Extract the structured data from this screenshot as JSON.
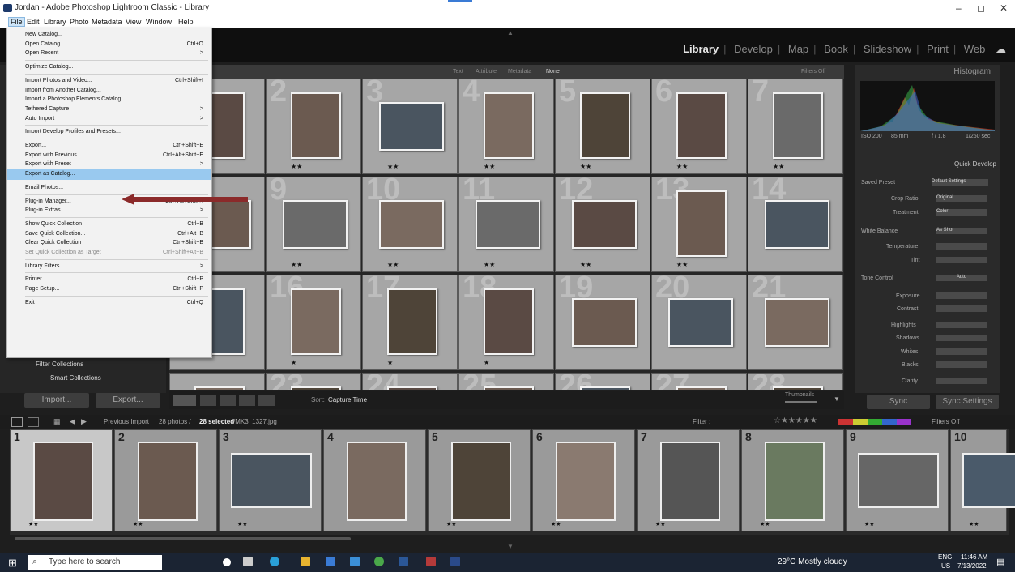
{
  "window": {
    "title": "Jordan - Adobe Photoshop Lightroom Classic - Library",
    "min": "–",
    "max": "◻",
    "close": "✕"
  },
  "menubar": [
    "File",
    "Edit",
    "Library",
    "Photo",
    "Metadata",
    "View",
    "Window",
    "Help"
  ],
  "modules": [
    "Library",
    "Develop",
    "Map",
    "Book",
    "Slideshow",
    "Print",
    "Web"
  ],
  "filter_bar": {
    "items": [
      "Text",
      "Attribute",
      "Metadata",
      "None"
    ],
    "right": "Filters Off"
  },
  "file_menu": [
    {
      "label": "New Catalog...",
      "shortcut": ""
    },
    {
      "label": "Open Catalog...",
      "shortcut": "Ctrl+O"
    },
    {
      "label": "Open Recent",
      "shortcut": ">"
    },
    {
      "sep": true
    },
    {
      "label": "Optimize Catalog...",
      "shortcut": ""
    },
    {
      "sep": true
    },
    {
      "label": "Import Photos and Video...",
      "shortcut": "Ctrl+Shift+I"
    },
    {
      "label": "Import from Another Catalog...",
      "shortcut": ""
    },
    {
      "label": "Import a Photoshop Elements Catalog...",
      "shortcut": ""
    },
    {
      "label": "Tethered Capture",
      "shortcut": ">"
    },
    {
      "label": "Auto Import",
      "shortcut": ">"
    },
    {
      "sep": true
    },
    {
      "label": "Import Develop Profiles and Presets...",
      "shortcut": ""
    },
    {
      "sep": true
    },
    {
      "label": "Export...",
      "shortcut": "Ctrl+Shift+E"
    },
    {
      "label": "Export with Previous",
      "shortcut": "Ctrl+Alt+Shift+E"
    },
    {
      "label": "Export with Preset",
      "shortcut": ">"
    },
    {
      "label": "Export as Catalog...",
      "shortcut": "",
      "highlight": true
    },
    {
      "sep": true
    },
    {
      "label": "Email Photos...",
      "shortcut": ""
    },
    {
      "sep": true
    },
    {
      "label": "Plug-in Manager...",
      "shortcut": "Ctrl+Alt+Shift+,"
    },
    {
      "label": "Plug-in Extras",
      "shortcut": ">"
    },
    {
      "sep": true
    },
    {
      "label": "Show Quick Collection",
      "shortcut": "Ctrl+B"
    },
    {
      "label": "Save Quick Collection...",
      "shortcut": "Ctrl+Alt+B"
    },
    {
      "label": "Clear Quick Collection",
      "shortcut": "Ctrl+Shift+B"
    },
    {
      "label": "Set Quick Collection as Target",
      "shortcut": "Ctrl+Shift+Alt+B",
      "dim": true
    },
    {
      "sep": true
    },
    {
      "label": "Library Filters",
      "shortcut": ">"
    },
    {
      "sep": true
    },
    {
      "label": "Printer...",
      "shortcut": "Ctrl+P"
    },
    {
      "label": "Page Setup...",
      "shortcut": "Ctrl+Shift+P"
    },
    {
      "sep": true
    },
    {
      "label": "Exit",
      "shortcut": "Ctrl+Q"
    }
  ],
  "left_panel": {
    "filter_collections": "Filter Collections",
    "smart_collections": "Smart Collections",
    "import": "Import...",
    "export": "Export..."
  },
  "grid": {
    "rows": [
      [
        {
          "n": "",
          "stars": ""
        },
        {
          "n": "2",
          "stars": "★★"
        },
        {
          "n": "3",
          "stars": "★★"
        },
        {
          "n": "4",
          "stars": "★★"
        },
        {
          "n": "5",
          "stars": "★★"
        },
        {
          "n": "6",
          "stars": "★★"
        },
        {
          "n": "7",
          "stars": "★★"
        }
      ],
      [
        {
          "n": "",
          "stars": ""
        },
        {
          "n": "9",
          "stars": "★★"
        },
        {
          "n": "10",
          "stars": "★★"
        },
        {
          "n": "11",
          "stars": "★★"
        },
        {
          "n": "12",
          "stars": "★★"
        },
        {
          "n": "13",
          "stars": "★★"
        },
        {
          "n": "14",
          "stars": ""
        }
      ],
      [
        {
          "n": "",
          "stars": ""
        },
        {
          "n": "16",
          "stars": "★"
        },
        {
          "n": "17",
          "stars": "★"
        },
        {
          "n": "18",
          "stars": "★"
        },
        {
          "n": "19",
          "stars": ""
        },
        {
          "n": "20",
          "stars": ""
        },
        {
          "n": "21",
          "stars": ""
        }
      ],
      [
        {
          "n": "",
          "stars": ""
        },
        {
          "n": "23",
          "stars": ""
        },
        {
          "n": "24",
          "stars": ""
        },
        {
          "n": "25",
          "stars": ""
        },
        {
          "n": "26",
          "stars": ""
        },
        {
          "n": "27",
          "stars": ""
        },
        {
          "n": "28",
          "stars": ""
        }
      ]
    ]
  },
  "toolbar": {
    "sort_label": "Sort:",
    "sort_value": "Capture Time",
    "thumbnails": "Thumbnails"
  },
  "right_panel": {
    "histogram": "Histogram",
    "info": [
      "ISO 200",
      "85 mm",
      "f / 1.8",
      "1/250 sec"
    ],
    "quick_develop": "Quick Develop",
    "saved_preset": "Saved Preset",
    "saved_preset_value": "Default Settings",
    "crop_ratio": "Crop Ratio",
    "crop_ratio_value": "Original",
    "treatment": "Treatment",
    "treatment_value": "Color",
    "white_balance": "White Balance",
    "white_balance_value": "As Shot",
    "temperature": "Temperature",
    "tint": "Tint",
    "tone_control": "Tone Control",
    "auto": "Auto",
    "exposure": "Exposure",
    "contrast": "Contrast",
    "highlights": "Highlights",
    "shadows": "Shadows",
    "whites": "Whites",
    "blacks": "Blacks",
    "clarity": "Clarity",
    "sync": "Sync",
    "sync_settings": "Sync Settings"
  },
  "filmstrip_bar": {
    "source": "Previous Import",
    "count": "28 photos /",
    "selected": "28 selected",
    "file": "/MK3_1327.jpg",
    "filter": "Filter :",
    "filters_off": "Filters Off"
  },
  "filmstrip": [
    {
      "n": "1",
      "stars": "★★"
    },
    {
      "n": "2",
      "stars": "★★"
    },
    {
      "n": "3",
      "stars": "★★"
    },
    {
      "n": "4",
      "stars": ""
    },
    {
      "n": "5",
      "stars": "★★"
    },
    {
      "n": "6",
      "stars": "★★"
    },
    {
      "n": "7",
      "stars": "★★"
    },
    {
      "n": "8",
      "stars": "★★"
    },
    {
      "n": "9",
      "stars": "★★"
    },
    {
      "n": "10",
      "stars": "★★"
    }
  ],
  "taskbar": {
    "search_placeholder": "Type here to search",
    "weather": "29°C  Mostly cloudy",
    "lang": "ENG",
    "region": "US",
    "time": "11:46 AM",
    "date": "7/13/2022"
  }
}
